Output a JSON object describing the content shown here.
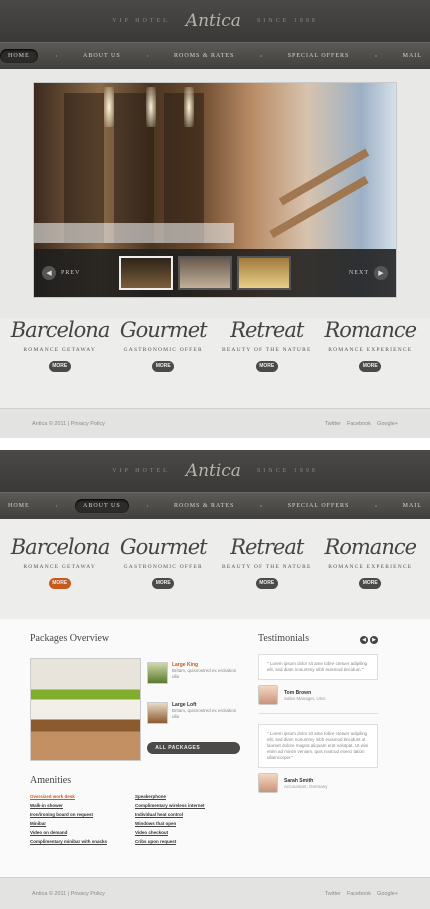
{
  "brand": {
    "left": "VIP HOTEL",
    "logo": "Antica",
    "right": "SINCE 1998"
  },
  "nav": [
    "HOME",
    "ABOUT US",
    "ROOMS & RATES",
    "SPECIAL OFFERS",
    "MAIL"
  ],
  "slider": {
    "prev": "PREV",
    "next": "NEXT"
  },
  "features": [
    {
      "title": "Barcelona",
      "sub": "ROMANCE GETAWAY",
      "more": "MORE"
    },
    {
      "title": "Gourmet",
      "sub": "GASTRONOMIC OFFER",
      "more": "MORE"
    },
    {
      "title": "Retreat",
      "sub": "BEAUTY OF THE NATURE",
      "more": "MORE"
    },
    {
      "title": "Romance",
      "sub": "ROMANCE EXPERIENCE",
      "more": "MORE"
    }
  ],
  "footer": {
    "copy": "Antica © 2011 | Privacy Policy",
    "links": [
      "Twitter",
      "Facebook",
      "Google+"
    ]
  },
  "packages": {
    "title": "Packages Overview",
    "items": [
      {
        "title": "Large King",
        "desc": "Britam, quisnostred ex ercitation ulla"
      },
      {
        "title": "Large Loft",
        "desc": "Britam, quisnostred ex ercitation ulla"
      }
    ],
    "button": "ALL PACKAGES"
  },
  "amenities": {
    "title": "Amenities",
    "items": [
      "Oversized work desk",
      "Speakerphone",
      "Walk-in shower",
      "Complimentary wireless internet",
      "Iron/ironing board on request",
      "Individual heat control",
      "Minibar",
      "Windows that open",
      "Video on demand",
      "Video checkout",
      "Complimentary minibar with snacks",
      "Cribs upon request"
    ]
  },
  "testimonials": {
    "title": "Testimonials",
    "items": [
      {
        "quote": "\" Lorem ipsum dolor sit ame tobre ctetuer adipiling elit, sed diam nonummy nibh euismod tincidum.\"",
        "name": "Tom Brown",
        "role": "Sales Manager, USA"
      },
      {
        "quote": "\" Lorem ipsum dolor sit ame tobre ctetuer adipiling elit, sed diam nonummy nibh euismod tincidunt ut laoreet dolore magna aliquam erat volutpat. Ut wisi enim ad minim veniam, quis nostrud exerci tation ullamcorper.\"",
        "name": "Sarah Smith",
        "role": "Accountant, Germany"
      }
    ]
  }
}
